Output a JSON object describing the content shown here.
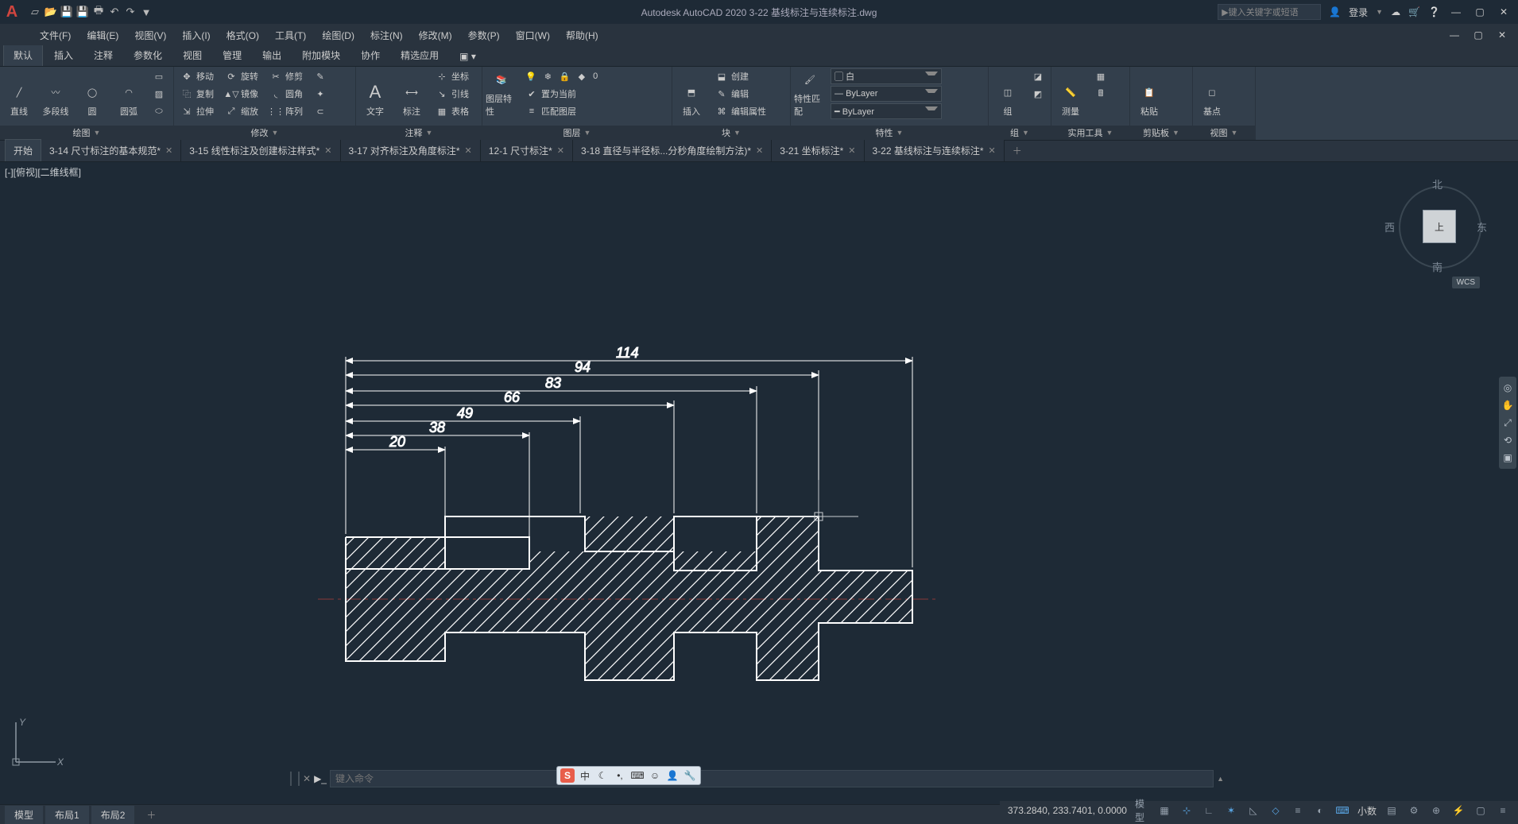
{
  "app": {
    "title": "Autodesk AutoCAD 2020    3-22 基线标注与连续标注.dwg"
  },
  "titlebar": {
    "search_placeholder": "键入关键字或短语",
    "login": "登录"
  },
  "menu": {
    "items": [
      "文件(F)",
      "编辑(E)",
      "视图(V)",
      "插入(I)",
      "格式(O)",
      "工具(T)",
      "绘图(D)",
      "标注(N)",
      "修改(M)",
      "参数(P)",
      "窗口(W)",
      "帮助(H)"
    ]
  },
  "ribbon_tabs": [
    "默认",
    "插入",
    "注释",
    "参数化",
    "视图",
    "管理",
    "输出",
    "附加模块",
    "协作",
    "精选应用"
  ],
  "panels": {
    "draw": {
      "title": "绘图",
      "line": "直线",
      "polyline": "多段线",
      "circle": "圆",
      "arc": "圆弧"
    },
    "modify": {
      "title": "修改",
      "move": "移动",
      "rotate": "旋转",
      "trim": "修剪",
      "copy": "复制",
      "mirror": "镜像",
      "fillet": "圆角",
      "stretch": "拉伸",
      "scale": "缩放",
      "array": "阵列"
    },
    "annot": {
      "title": "注释",
      "text": "文字",
      "dim": "标注",
      "leader": "引线",
      "table": "表格",
      "coord": "坐标"
    },
    "layer": {
      "title": "图层",
      "props": "图层特性",
      "current": "置为当前",
      "match": "匹配图层"
    },
    "block": {
      "title": "块",
      "insert": "插入",
      "create": "创建",
      "edit": "编辑",
      "editattr": "编辑属性"
    },
    "props": {
      "title": "特性",
      "match": "特性匹配",
      "white": "白",
      "bylayer": "ByLayer"
    },
    "group": {
      "title": "组",
      "group": "组"
    },
    "util": {
      "title": "实用工具",
      "measure": "测量"
    },
    "clip": {
      "title": "剪贴板",
      "paste": "粘贴"
    },
    "view": {
      "title": "视图",
      "base": "基点"
    }
  },
  "doc_tabs": [
    {
      "label": "开始"
    },
    {
      "label": "3-14 尺寸标注的基本规范*"
    },
    {
      "label": "3-15 线性标注及创建标注样式*"
    },
    {
      "label": "3-17 对齐标注及角度标注*"
    },
    {
      "label": "12-1 尺寸标注*"
    },
    {
      "label": "3-18 直径与半径标...分秒角度绘制方法)*"
    },
    {
      "label": "3-21 坐标标注*"
    },
    {
      "label": "3-22 基线标注与连续标注*"
    }
  ],
  "viewport": {
    "label": "[-][俯视][二维线框]"
  },
  "viewcube": {
    "n": "北",
    "s": "南",
    "e": "东",
    "w": "西",
    "top": "上",
    "wcs": "WCS"
  },
  "ucs": {
    "x": "X",
    "y": "Y"
  },
  "command": {
    "placeholder": "键入命令"
  },
  "layout_tabs": [
    "模型",
    "布局1",
    "布局2"
  ],
  "status": {
    "coords": "373.2840, 233.7401, 0.0000",
    "model": "模型",
    "decimal": "小数"
  },
  "ime": {
    "s": "S",
    "zhong": "中"
  },
  "drawing": {
    "dims": [
      "114",
      "94",
      "83",
      "66",
      "49",
      "38",
      "20"
    ]
  }
}
